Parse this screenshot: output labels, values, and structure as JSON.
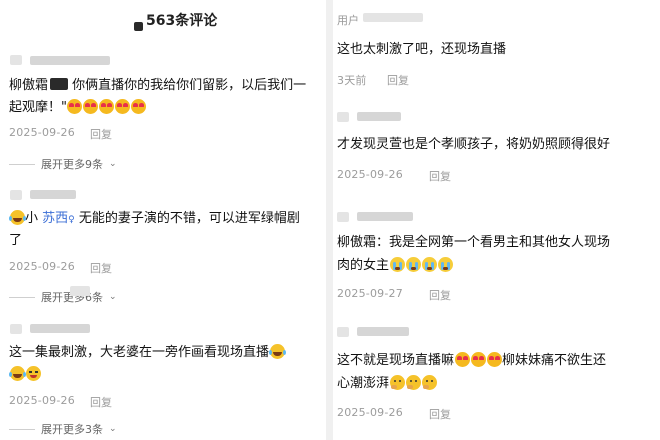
{
  "left": {
    "header_title": "563条评论",
    "comments": [
      {
        "author": "柳傲霜",
        "text_line1_prefix": "柳傲霜",
        "text_line1_a": "  你俩直播你的我给你们留影，以后我们一",
        "text_line2": "起观摩！\"",
        "emojis": [
          "heart-eyes-icon",
          "heart-eyes-icon",
          "heart-eyes-icon",
          "heart-eyes-icon",
          "heart-eyes-icon"
        ],
        "date": "2025-09-26",
        "reply": "回复",
        "expand": "展开更多9条"
      },
      {
        "mention": "苏西",
        "text_line1_prefix": "小",
        "text_line1_after": " 无能的妻子演的不错，可以进军绿帽剧",
        "text_line2": "了",
        "date": "2025-09-26",
        "reply": "回复",
        "expand": "展开更多6条"
      },
      {
        "text_line1": "这一集最刺激，大老婆在一旁作画看现场直播",
        "date": "2025-09-26",
        "reply": "回复",
        "expand": "展开更多3条"
      }
    ]
  },
  "right": {
    "user_placeholder": "用户",
    "comments": [
      {
        "text_line1": "这也太刺激了吧，还现场直播",
        "date": "3天前",
        "reply": "回复"
      },
      {
        "text_line1": "才发现灵萱也是个孝顺孩子，将奶奶照顾得很好",
        "date": "2025-09-26",
        "reply": "回复"
      },
      {
        "text_line1": "柳傲霜：我是全网第一个看男主和其他女人现场",
        "text_line2": "肉的女主",
        "date": "2025-09-27",
        "reply": "回复"
      },
      {
        "text_line1_a": "这不就是现场直播嘛",
        "text_line1_b": "柳妹妹痛不欲生还",
        "text_line2": "心潮澎湃",
        "date": "2025-09-26",
        "reply": "回复"
      }
    ]
  }
}
